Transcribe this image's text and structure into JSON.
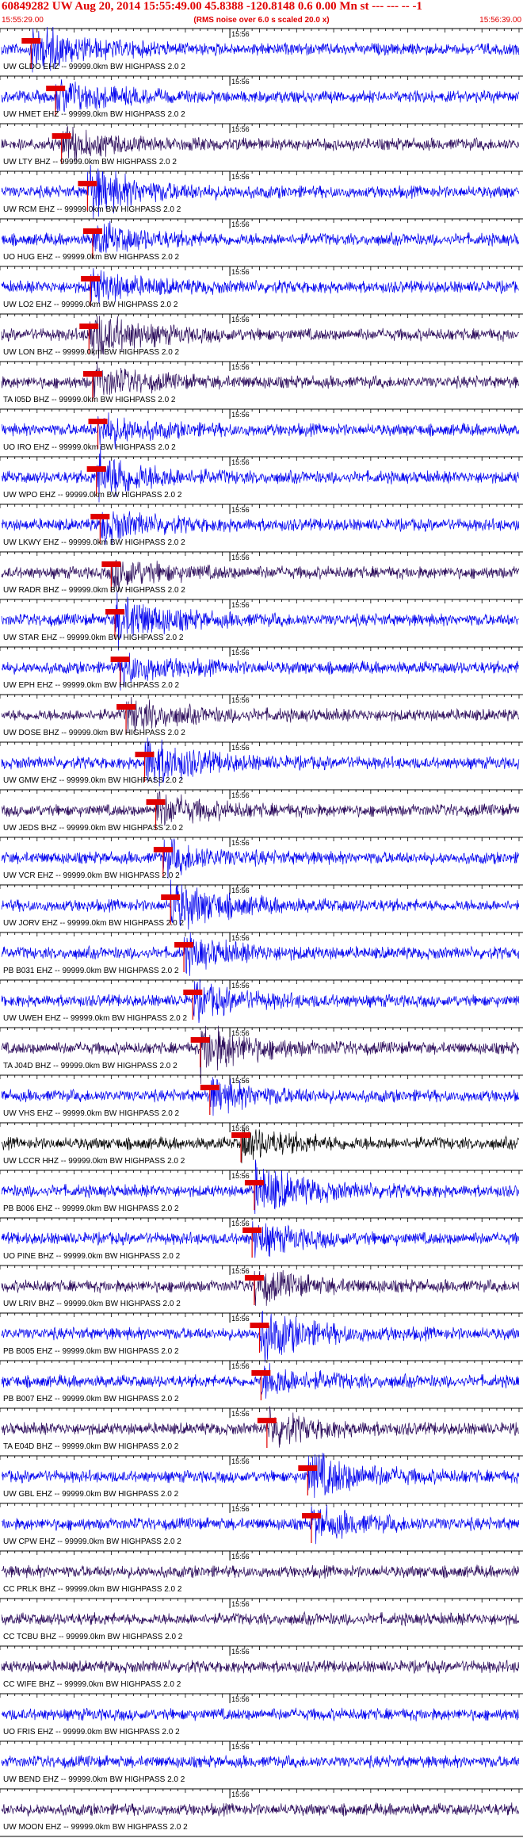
{
  "header": {
    "title": "60849282 UW Aug 20, 2014 15:55:49.00   45.8388 -120.8148  0.6 0.00 Mn st --- --- --  -1",
    "subtitle": "(RMS noise over 6.0 s scaled 20.0 x)",
    "time_start": "15:55:29.00",
    "time_end": "15:56:39.00"
  },
  "chart_data": {
    "type": "seismogram",
    "time_range_s": [
      0,
      70
    ],
    "minute_tick_label": "15:56",
    "minute_tick_time_s": 31,
    "trace_colors": {
      "blue": "#0000ee",
      "purple": "#2a0a5a",
      "black": "#000000"
    },
    "pick_color": "#e00000",
    "traces": [
      {
        "label": "UW GLDO EHZ -- 99999.0km BW  HIGHPASS  2.0  2",
        "color": "blue",
        "pick_s": 4.2
      },
      {
        "label": "UW HMET EHZ -- 99999.0km BW  HIGHPASS  2.0  2",
        "color": "blue",
        "pick_s": 7.5
      },
      {
        "label": "UW LTY BHZ -- 99999.0km BW  HIGHPASS  2.0  2",
        "color": "purple",
        "pick_s": 8.3
      },
      {
        "label": "UW RCM EHZ -- 99999.0km BW  HIGHPASS  2.0  2",
        "color": "blue",
        "pick_s": 11.8
      },
      {
        "label": "UO HUG EHZ -- 99999.0km BW  HIGHPASS  2.0  2",
        "color": "blue",
        "pick_s": 12.5
      },
      {
        "label": "UW LO2 EHZ -- 99999.0km BW  HIGHPASS  2.0  2",
        "color": "blue",
        "pick_s": 12.2
      },
      {
        "label": "UW LON BHZ -- 99999.0km BW  HIGHPASS  2.0  2",
        "color": "purple",
        "pick_s": 12.0
      },
      {
        "label": "TA I05D BHZ -- 99999.0km BW  HIGHPASS  2.0  2",
        "color": "purple",
        "pick_s": 12.5
      },
      {
        "label": "UO IRO EHZ -- 99999.0km BW  HIGHPASS  2.0  2",
        "color": "blue",
        "pick_s": 13.2
      },
      {
        "label": "UW WPO EHZ -- 99999.0km BW  HIGHPASS  2.0  2",
        "color": "blue",
        "pick_s": 13.0
      },
      {
        "label": "UW LKWY EHZ -- 99999.0km BW  HIGHPASS  2.0  2",
        "color": "blue",
        "pick_s": 13.5
      },
      {
        "label": "UW RADR BHZ -- 99999.0km BW  HIGHPASS  2.0  2",
        "color": "purple",
        "pick_s": 15.0
      },
      {
        "label": "UW STAR EHZ -- 99999.0km BW  HIGHPASS  2.0  2",
        "color": "blue",
        "pick_s": 15.5
      },
      {
        "label": "UW EPH EHZ -- 99999.0km BW  HIGHPASS  2.0  2",
        "color": "blue",
        "pick_s": 16.2
      },
      {
        "label": "UW DOSE BHZ -- 99999.0km BW  HIGHPASS  2.0  2",
        "color": "purple",
        "pick_s": 17.0
      },
      {
        "label": "UW GMW EHZ -- 99999.0km BW  HIGHPASS  2.0  2",
        "color": "blue",
        "pick_s": 19.5
      },
      {
        "label": "UW JEDS BHZ -- 99999.0km BW  HIGHPASS  2.0  2",
        "color": "purple",
        "pick_s": 21.0
      },
      {
        "label": "UW VCR EHZ -- 99999.0km BW  HIGHPASS  2.0  2",
        "color": "blue",
        "pick_s": 22.0
      },
      {
        "label": "UW JORV EHZ -- 99999.0km BW  HIGHPASS  2.0  2",
        "color": "blue",
        "pick_s": 23.0
      },
      {
        "label": "PB B031 EHZ -- 99999.0km BW  HIGHPASS  2.0  2",
        "color": "blue",
        "pick_s": 24.8
      },
      {
        "label": "UW UWEH EHZ -- 99999.0km BW  HIGHPASS  2.0  2",
        "color": "blue",
        "pick_s": 26.0
      },
      {
        "label": "TA J04D BHZ -- 99999.0km BW  HIGHPASS  2.0  2",
        "color": "purple",
        "pick_s": 27.0
      },
      {
        "label": "UW VHS EHZ -- 99999.0km BW  HIGHPASS  2.0  2",
        "color": "blue",
        "pick_s": 28.3
      },
      {
        "label": "UW LCCR HHZ -- 99999.0km BW  HIGHPASS  2.0  2",
        "color": "black",
        "pick_s": 32.5
      },
      {
        "label": "PB B006 EHZ -- 99999.0km BW  HIGHPASS  2.0  2",
        "color": "blue",
        "pick_s": 34.3
      },
      {
        "label": "UO PINE BHZ -- 99999.0km BW  HIGHPASS  2.0  2",
        "color": "blue",
        "pick_s": 34.0
      },
      {
        "label": "UW LRIV BHZ -- 99999.0km BW  HIGHPASS  2.0  2",
        "color": "purple",
        "pick_s": 34.3
      },
      {
        "label": "PB B005 EHZ -- 99999.0km BW  HIGHPASS  2.0  2",
        "color": "blue",
        "pick_s": 35.0
      },
      {
        "label": "PB B007 EHZ -- 99999.0km BW  HIGHPASS  2.0  2",
        "color": "blue",
        "pick_s": 35.2
      },
      {
        "label": "TA E04D BHZ -- 99999.0km BW  HIGHPASS  2.0  2",
        "color": "purple",
        "pick_s": 36.0
      },
      {
        "label": "UW GBL EHZ -- 99999.0km BW  HIGHPASS  2.0  2",
        "color": "blue",
        "pick_s": 41.5
      },
      {
        "label": "UW CPW EHZ -- 99999.0km BW  HIGHPASS  2.0  2",
        "color": "blue",
        "pick_s": 42.0
      },
      {
        "label": "CC PRLK BHZ -- 99999.0km BW  HIGHPASS  2.0  2",
        "color": "purple",
        "pick_s": null
      },
      {
        "label": "CC TCBU BHZ -- 99999.0km BW  HIGHPASS  2.0  2",
        "color": "purple",
        "pick_s": null
      },
      {
        "label": "CC WIFE BHZ -- 99999.0km BW  HIGHPASS  2.0  2",
        "color": "purple",
        "pick_s": null
      },
      {
        "label": "UO FRIS EHZ -- 99999.0km BW  HIGHPASS  2.0  2",
        "color": "blue",
        "pick_s": null
      },
      {
        "label": "UW BEND EHZ -- 99999.0km BW  HIGHPASS  2.0  2",
        "color": "blue",
        "pick_s": null
      },
      {
        "label": "UW MOON EHZ -- 99999.0km BW  HIGHPASS  2.0  2",
        "color": "purple",
        "pick_s": null
      }
    ]
  }
}
